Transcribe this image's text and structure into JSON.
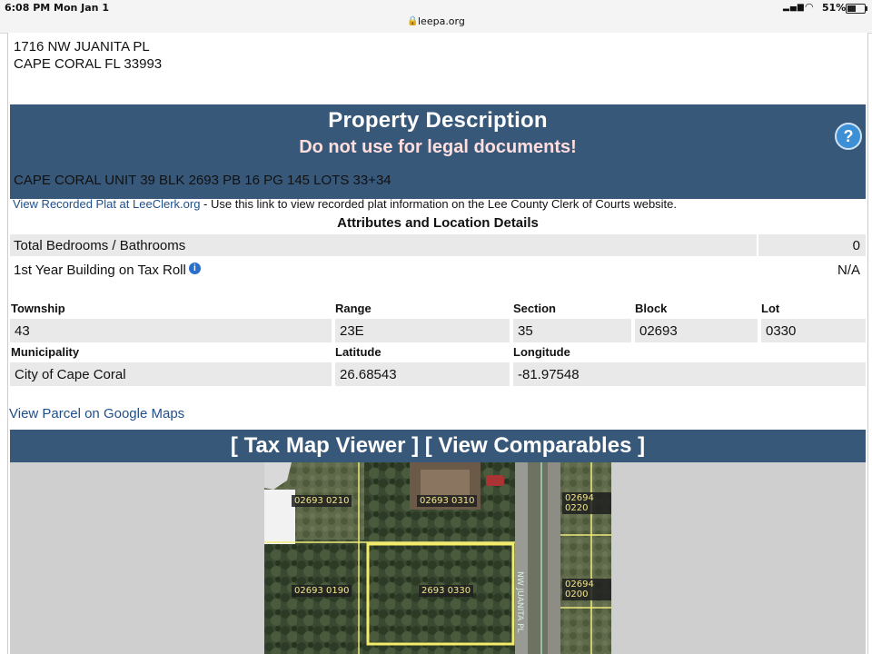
{
  "status_bar": {
    "time": "6:08 PM",
    "date": "Mon Jan 1",
    "battery": "51%",
    "url": "leepa.org"
  },
  "address": {
    "line1": "1716 NW JUANITA PL",
    "line2": "CAPE CORAL FL 33993"
  },
  "property_description": {
    "title": "Property Description",
    "warning": "Do not use for legal documents!",
    "help_label": "?",
    "legal_description": "CAPE CORAL UNIT 39 BLK 2693 PB 16 PG 145 LOTS 33+34",
    "plat_link": "View Recorded Plat at LeeClerk.org",
    "plat_text": " - Use this link to view recorded plat information on the Lee County Clerk of Courts website."
  },
  "attributes": {
    "heading": "Attributes and Location Details",
    "bed_bath_label": "Total Bedrooms / Bathrooms",
    "bed_bath_value": "0",
    "year_label": "1st Year Building on Tax Roll",
    "year_value": "N/A"
  },
  "location": {
    "township_label": "Township",
    "township": "43",
    "range_label": "Range",
    "range": "23E",
    "section_label": "Section",
    "section": "35",
    "block_label": "Block",
    "block": "02693",
    "lot_label": "Lot",
    "lot": "0330",
    "municipality_label": "Municipality",
    "municipality": "City of Cape Coral",
    "latitude_label": "Latitude",
    "latitude": "26.68543",
    "longitude_label": "Longitude",
    "longitude": "-81.97548"
  },
  "google_maps_link": "View Parcel on Google Maps",
  "tax_map": {
    "viewer_link": "[ Tax Map Viewer ]",
    "comparables_link": "[ View Comparables ]",
    "parcels": [
      "02693 0210",
      "02693 0310",
      "02694 0220",
      "02693 0190",
      "2693 0330",
      "02694 0200"
    ],
    "street": "NW JUANITA PL"
  }
}
